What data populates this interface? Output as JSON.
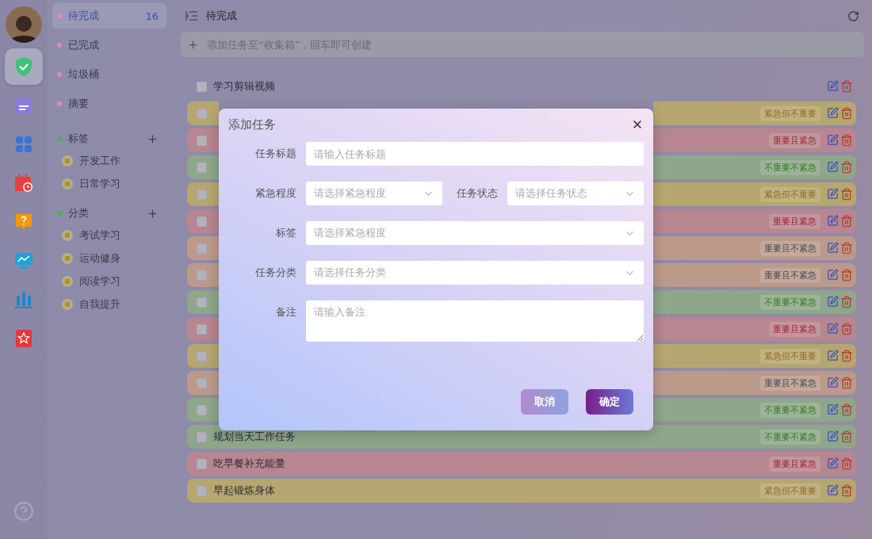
{
  "rail": [
    {
      "kind": "avatar",
      "selected": false
    },
    {
      "kind": "shield",
      "selected": true
    },
    {
      "kind": "calendar",
      "selected": false
    },
    {
      "kind": "grid",
      "selected": false
    },
    {
      "kind": "schedule",
      "selected": false
    },
    {
      "kind": "question",
      "selected": false
    },
    {
      "kind": "monitor",
      "selected": false
    },
    {
      "kind": "bars",
      "selected": false
    },
    {
      "kind": "box",
      "selected": false
    }
  ],
  "nav": {
    "items": [
      {
        "label": "待完成",
        "count": "16",
        "selected": true
      },
      {
        "label": "已完成",
        "selected": false
      },
      {
        "label": "垃圾桶",
        "selected": false
      },
      {
        "label": "摘要",
        "selected": false
      }
    ],
    "sections": [
      {
        "title": "标签",
        "items": [
          "开发工作",
          "日常学习"
        ]
      },
      {
        "title": "分类",
        "items": [
          "考试学习",
          "运动健身",
          "阅读学习",
          "自我提升"
        ]
      }
    ]
  },
  "header": {
    "title": "待完成"
  },
  "add_task": {
    "placeholder": "添加任务至“收集箱”，回车即可创建"
  },
  "tasks": [
    {
      "title": "学习剪辑视频",
      "checked": false
    },
    {
      "tag": "紧急但不重要",
      "color": "#b6a66f",
      "checked": false
    },
    {
      "tag": "重要且紧急",
      "color": "#b78690",
      "checked": false
    },
    {
      "tag": "不重要不紧急",
      "color": "#8ea68a",
      "checked": false
    },
    {
      "tag": "紧急但不重要",
      "color": "#b6a66f",
      "checked": false
    },
    {
      "tag": "重要且紧急",
      "color": "#b78690",
      "checked": false
    },
    {
      "tag": "重要且不紧急",
      "color": "#bb9a8a",
      "checked": false
    },
    {
      "tag": "重要且不紧急",
      "color": "#bb9a8a",
      "checked": false
    },
    {
      "tag": "不重要不紧急",
      "color": "#8ea68a",
      "checked": false
    },
    {
      "tag": "重要且紧急",
      "color": "#b78690",
      "checked": false
    },
    {
      "tag": "紧急但不重要",
      "color": "#b6a66f",
      "checked": false
    },
    {
      "tag": "重要且不紧急",
      "color": "#bb9a8a",
      "checked": false
    },
    {
      "tag": "不重要不紧急",
      "color": "#8ea68a",
      "checked": false
    },
    {
      "title": "规划当天工作任务",
      "tag": "不重要不紧急",
      "color": "#8ea68a",
      "checked": false
    },
    {
      "title": "吃早餐补充能量",
      "tag": "重要且紧急",
      "color": "#b78690",
      "checked": false
    },
    {
      "title": "早起锻炼身体",
      "tag": "紧急但不重要",
      "color": "#b6a66f",
      "checked": false
    }
  ],
  "dialog": {
    "title": "添加任务",
    "fields": [
      [
        {
          "label": "任务标题",
          "kind": "input",
          "placeholder": "请输入任务标题"
        }
      ],
      [
        {
          "label": "紧急程度",
          "kind": "select",
          "placeholder": "请选择紧急程度"
        },
        {
          "label": "任务状态",
          "kind": "select",
          "placeholder": "请选择任务状态"
        }
      ],
      [
        {
          "label": "标签",
          "kind": "select",
          "placeholder": "请选择紧急程度"
        }
      ],
      [
        {
          "label": "任务分类",
          "kind": "select",
          "placeholder": "请选择任务分类"
        }
      ],
      [
        {
          "label": "备注",
          "kind": "textarea",
          "placeholder": "请输入备注"
        }
      ]
    ],
    "buttons": [
      {
        "label": "取消",
        "kind": "secondary"
      },
      {
        "label": "确定",
        "kind": "primary"
      }
    ]
  }
}
